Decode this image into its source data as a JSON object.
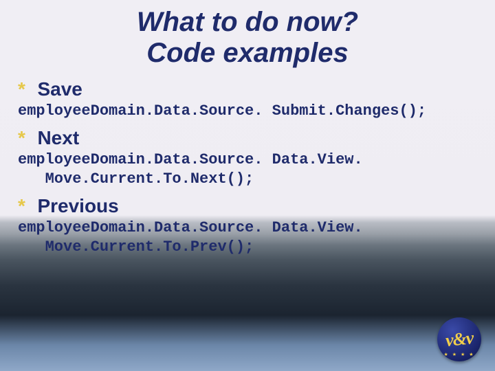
{
  "title": {
    "line1": "What to do now?",
    "line2": "Code examples"
  },
  "items": [
    {
      "heading": "Save",
      "code": "employeeDomain.Data.Source. Submit.Changes();"
    },
    {
      "heading": "Next",
      "code": "employeeDomain.Data.Source. Data.View.\n   Move.Current.To.Next();"
    },
    {
      "heading": "Previous",
      "code": "employeeDomain.Data.Source. Data.View.\n   Move.Current.To.Prev();"
    }
  ],
  "logo": {
    "text": "v&v"
  }
}
